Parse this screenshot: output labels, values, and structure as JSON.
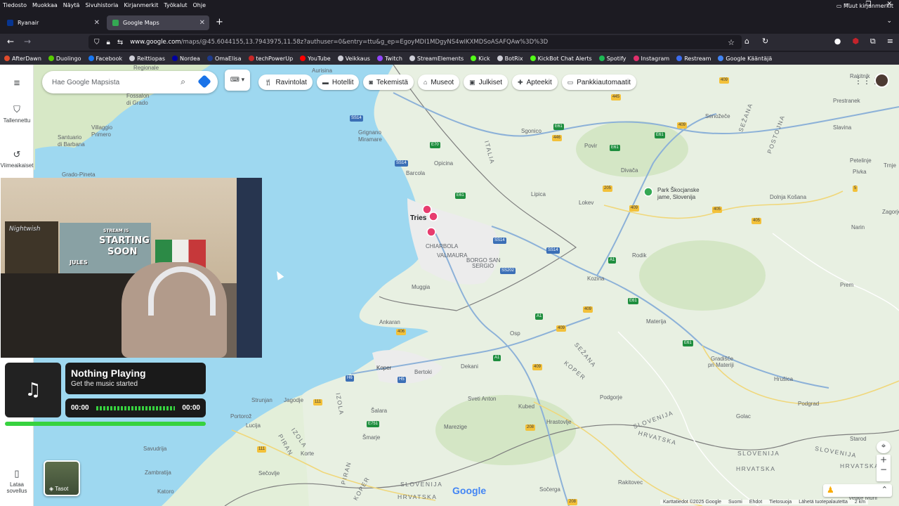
{
  "menubar": [
    "Tiedosto",
    "Muokkaa",
    "Näytä",
    "Sivuhistoria",
    "Kirjanmerkit",
    "Työkalut",
    "Ohje"
  ],
  "tabs": [
    {
      "title": "Ryanair"
    },
    {
      "title": "Google Maps"
    }
  ],
  "address_bar": {
    "host": "www.google.com",
    "path": "/maps/@45.6044155,13.7943975,11.58z?authuser=0&entry=ttu&g_ep=EgoyMDI1MDgyNS4wIKXMDSoASAFQAw%3D%3D"
  },
  "bookmarks": [
    {
      "label": "AfterDawn",
      "color": "#e04b2c"
    },
    {
      "label": "Duolingo",
      "color": "#58cc02"
    },
    {
      "label": "Facebook",
      "color": "#1877f2"
    },
    {
      "label": "Reittiopas",
      "color": "#cfcfd8"
    },
    {
      "label": "Nordea",
      "color": "#0000a0"
    },
    {
      "label": "OmaElisa",
      "color": "#1d3b8c"
    },
    {
      "label": "techPowerUp",
      "color": "#c82828"
    },
    {
      "label": "YouTube",
      "color": "#ff0000"
    },
    {
      "label": "Veikkaus",
      "color": "#cfcfd8"
    },
    {
      "label": "Twitch",
      "color": "#9146ff"
    },
    {
      "label": "StreamElements",
      "color": "#cfcfd8"
    },
    {
      "label": "Kick",
      "color": "#53fc18"
    },
    {
      "label": "BotRix",
      "color": "#cfcfd8"
    },
    {
      "label": "KickBot Chat Alerts",
      "color": "#53fc18"
    },
    {
      "label": "Spotify",
      "color": "#1db954"
    },
    {
      "label": "Instagram",
      "color": "#e1306c"
    },
    {
      "label": "Restream",
      "color": "#3c6cf0"
    },
    {
      "label": "Google Kääntäjä",
      "color": "#4285f4"
    }
  ],
  "bookmarks_other": "Muut kirjanmerkit",
  "maps": {
    "search_placeholder": "Hae Google Mapsista",
    "rail": {
      "saved": "Tallennettu",
      "recent": "Viimeaikaiset",
      "get_app": "Lataa sovellus"
    },
    "chips": [
      {
        "label": "Ravintolat",
        "icon": "fork-knife-icon"
      },
      {
        "label": "Hotellit",
        "icon": "bed-icon"
      },
      {
        "label": "Tekemistä",
        "icon": "camera-icon"
      },
      {
        "label": "Museot",
        "icon": "museum-icon"
      },
      {
        "label": "Julkiset",
        "icon": "train-icon"
      },
      {
        "label": "Apteekit",
        "icon": "pharmacy-icon"
      },
      {
        "label": "Pankkiautomaatit",
        "icon": "atm-icon"
      }
    ],
    "layers_label": "Tasot",
    "footer": [
      "Karttatiedot ©2025 Google",
      "Suomi",
      "Ehdot",
      "Tietosuoja",
      "Lähetä tuotepalautetta",
      "2 km"
    ],
    "logo": "Google",
    "places": [
      {
        "name": "Regionale",
        "cls": "",
        "id": "p-regionale"
      },
      {
        "name": "Aurisina",
        "cls": "",
        "id": "p-aurisina"
      },
      {
        "name": "Fossalon",
        "cls": "",
        "id": "p-fossalon"
      },
      {
        "name": "di Grado",
        "cls": "",
        "id": "p-digrado"
      },
      {
        "name": "Santuario",
        "cls": "",
        "id": "p-santuario"
      },
      {
        "name": "di Barbana",
        "cls": "",
        "id": "p-dibarbana"
      },
      {
        "name": "Villaggio",
        "cls": "",
        "id": "p-villaggio"
      },
      {
        "name": "Primero",
        "cls": "",
        "id": "p-primero"
      },
      {
        "name": "Grado-Pineta",
        "cls": "",
        "id": "p-gradopineta"
      },
      {
        "name": "Grignano",
        "cls": "",
        "id": "p-grignano"
      },
      {
        "name": "Miramare",
        "cls": "",
        "id": "p-miramare"
      },
      {
        "name": "Sgonico",
        "cls": "",
        "id": "p-sgonico"
      },
      {
        "name": "Opicina",
        "cls": "",
        "id": "p-opicina"
      },
      {
        "name": "Barcola",
        "cls": "",
        "id": "p-barcola"
      },
      {
        "name": "Tries",
        "cls": "big",
        "id": "p-trieste"
      },
      {
        "name": "CHIARBOLA",
        "cls": "",
        "id": "p-chiarbola"
      },
      {
        "name": "VALMAURA",
        "cls": "",
        "id": "p-valmaura"
      },
      {
        "name": "BORGO SAN",
        "cls": "",
        "id": "p-borgosan"
      },
      {
        "name": "SERGIO",
        "cls": "",
        "id": "p-sergio"
      },
      {
        "name": "Muggia",
        "cls": "",
        "id": "p-muggia"
      },
      {
        "name": "Ankaran",
        "cls": "",
        "id": "p-ankaran"
      },
      {
        "name": "Koper",
        "cls": "dark",
        "id": "p-koper"
      },
      {
        "name": "Bertoki",
        "cls": "",
        "id": "p-bertoki"
      },
      {
        "name": "Dekani",
        "cls": "",
        "id": "p-dekani"
      },
      {
        "name": "Osp",
        "cls": "",
        "id": "p-osp"
      },
      {
        "name": "Sveti Anton",
        "cls": "",
        "id": "p-svetianton"
      },
      {
        "name": "Kubed",
        "cls": "",
        "id": "p-kubed"
      },
      {
        "name": "Marezige",
        "cls": "",
        "id": "p-marezige"
      },
      {
        "name": "Hrastovlje",
        "cls": "",
        "id": "p-hrastovlje"
      },
      {
        "name": "Podgorje",
        "cls": "",
        "id": "p-podgorje"
      },
      {
        "name": "Strunjan",
        "cls": "",
        "id": "p-strunjan"
      },
      {
        "name": "Jagodje",
        "cls": "",
        "id": "p-jagodje"
      },
      {
        "name": "Šalara",
        "cls": "",
        "id": "p-salara"
      },
      {
        "name": "Portorož",
        "cls": "",
        "id": "p-portoroz"
      },
      {
        "name": "Lucija",
        "cls": "",
        "id": "p-lucija"
      },
      {
        "name": "Šmarje",
        "cls": "",
        "id": "p-smarje"
      },
      {
        "name": "Savudrija",
        "cls": "",
        "id": "p-savudrija"
      },
      {
        "name": "Zambratija",
        "cls": "",
        "id": "p-zambratija"
      },
      {
        "name": "Katoro",
        "cls": "",
        "id": "p-katoro"
      },
      {
        "name": "Korte",
        "cls": "",
        "id": "p-korte"
      },
      {
        "name": "Sečovlje",
        "cls": "",
        "id": "p-secovlje"
      },
      {
        "name": "Sočerga",
        "cls": "",
        "id": "p-socerga"
      },
      {
        "name": "Rakitovec",
        "cls": "",
        "id": "p-rakitovec"
      },
      {
        "name": "Golac",
        "cls": "",
        "id": "p-golac"
      },
      {
        "name": "Starod",
        "cls": "",
        "id": "p-starod"
      },
      {
        "name": "Podgrad",
        "cls": "",
        "id": "p-podgrad"
      },
      {
        "name": "Hrušica",
        "cls": "",
        "id": "p-hrusica"
      },
      {
        "name": "Gradišče",
        "cls": "",
        "id": "p-gradisce"
      },
      {
        "name": "pri Materiji",
        "cls": "",
        "id": "p-primateriji"
      },
      {
        "name": "Materija",
        "cls": "",
        "id": "p-materija"
      },
      {
        "name": "Kozina",
        "cls": "",
        "id": "p-kozina"
      },
      {
        "name": "Rodik",
        "cls": "",
        "id": "p-rodik"
      },
      {
        "name": "Lokev",
        "cls": "",
        "id": "p-lokev"
      },
      {
        "name": "Lipica",
        "cls": "",
        "id": "p-lipica"
      },
      {
        "name": "Divača",
        "cls": "",
        "id": "p-divaca"
      },
      {
        "name": "Povir",
        "cls": "",
        "id": "p-povir"
      },
      {
        "name": "Senožeče",
        "cls": "",
        "id": "p-senozece"
      },
      {
        "name": "Prestranek",
        "cls": "",
        "id": "p-prestranek"
      },
      {
        "name": "Slavina",
        "cls": "",
        "id": "p-slavina"
      },
      {
        "name": "Petelinje",
        "cls": "",
        "id": "p-petelinje"
      },
      {
        "name": "Pivka",
        "cls": "",
        "id": "p-pivka"
      },
      {
        "name": "Trnje",
        "cls": "",
        "id": "p-trnje"
      },
      {
        "name": "Dolnja Košana",
        "cls": "",
        "id": "p-dolnjakosana"
      },
      {
        "name": "Narin",
        "cls": "",
        "id": "p-narin"
      },
      {
        "name": "Zagorje",
        "cls": "",
        "id": "p-zagorje"
      },
      {
        "name": "Prem",
        "cls": "",
        "id": "p-prem"
      },
      {
        "name": "Rakitnik",
        "cls": "",
        "id": "p-rakitnik"
      },
      {
        "name": "Velike Muni",
        "cls": "",
        "id": "p-velikemuni"
      },
      {
        "name": "Park Škocjanske",
        "cls": "dark",
        "id": "p-park1"
      },
      {
        "name": "jame, Slovenija",
        "cls": "dark",
        "id": "p-park2"
      },
      {
        "name": "SLOVENIJA",
        "cls": "region",
        "id": "p-slov1"
      },
      {
        "name": "SLOVENIJA",
        "cls": "region",
        "id": "p-slov2"
      },
      {
        "name": "HRVATSKA",
        "cls": "region",
        "id": "p-hrv1"
      },
      {
        "name": "HRVATSKA",
        "cls": "region",
        "id": "p-hrv2"
      },
      {
        "name": "SLOVENIJA",
        "cls": "region",
        "id": "p-slov3"
      },
      {
        "name": "HRVATSKA",
        "cls": "region",
        "id": "p-hrv3"
      },
      {
        "name": "SLOVENIJA",
        "cls": "region",
        "id": "p-slov4"
      },
      {
        "name": "HRVATSKA",
        "cls": "region",
        "id": "p-hrv4"
      },
      {
        "name": "ITALIA",
        "cls": "region",
        "id": "p-italia"
      },
      {
        "name": "SEŽANA",
        "cls": "region",
        "id": "p-sezana1"
      },
      {
        "name": "POSTOJNA",
        "cls": "region",
        "id": "p-postojna"
      },
      {
        "name": "SEŽANA",
        "cls": "region",
        "id": "p-sezana2"
      },
      {
        "name": "KOPER",
        "cls": "region",
        "id": "p-koperreg"
      },
      {
        "name": "IZOLA",
        "cls": "region",
        "id": "p-izola1"
      },
      {
        "name": "IZOLA",
        "cls": "region",
        "id": "p-izola2"
      },
      {
        "name": "PIRAN",
        "cls": "region",
        "id": "p-piran1"
      },
      {
        "name": "PIRAN",
        "cls": "region",
        "id": "p-piran2"
      },
      {
        "name": "KOPER",
        "cls": "region",
        "id": "p-koper2"
      }
    ],
    "shields": [
      {
        "label": "445",
        "kind": "y",
        "id": "s1"
      },
      {
        "label": "409",
        "kind": "y",
        "id": "s2"
      },
      {
        "label": "409",
        "kind": "y",
        "id": "s3"
      },
      {
        "label": "446",
        "kind": "y",
        "id": "s4"
      },
      {
        "label": "E61",
        "kind": "g",
        "id": "s5"
      },
      {
        "label": "E61",
        "kind": "g",
        "id": "s6"
      },
      {
        "label": "E61",
        "kind": "g",
        "id": "s7"
      },
      {
        "label": "E70",
        "kind": "g",
        "id": "s8"
      },
      {
        "label": "E61",
        "kind": "g",
        "id": "s9"
      },
      {
        "label": "SS14",
        "kind": "b",
        "id": "s10"
      },
      {
        "label": "SS14",
        "kind": "b",
        "id": "s11"
      },
      {
        "label": "SS14",
        "kind": "b",
        "id": "s12"
      },
      {
        "label": "SS14",
        "kind": "b",
        "id": "s13"
      },
      {
        "label": "SS202",
        "kind": "b",
        "id": "s14"
      },
      {
        "label": "A1",
        "kind": "g",
        "id": "s15"
      },
      {
        "label": "A1",
        "kind": "g",
        "id": "s16"
      },
      {
        "label": "A1",
        "kind": "g",
        "id": "s17"
      },
      {
        "label": "E61",
        "kind": "g",
        "id": "s18"
      },
      {
        "label": "E61",
        "kind": "g",
        "id": "s19"
      },
      {
        "label": "409",
        "kind": "y",
        "id": "s20"
      },
      {
        "label": "409",
        "kind": "y",
        "id": "s21"
      },
      {
        "label": "406",
        "kind": "y",
        "id": "s22"
      },
      {
        "label": "405",
        "kind": "y",
        "id": "s23"
      },
      {
        "label": "405",
        "kind": "y",
        "id": "s24"
      },
      {
        "label": "205",
        "kind": "y",
        "id": "s25"
      },
      {
        "label": "5",
        "kind": "y",
        "id": "s26"
      },
      {
        "label": "H6",
        "kind": "b",
        "id": "s27"
      },
      {
        "label": "H5",
        "kind": "b",
        "id": "s28"
      },
      {
        "label": "111",
        "kind": "y",
        "id": "s29"
      },
      {
        "label": "111",
        "kind": "y",
        "id": "s30"
      },
      {
        "label": "E751",
        "kind": "g",
        "id": "s31"
      },
      {
        "label": "208",
        "kind": "y",
        "id": "s32"
      },
      {
        "label": "208",
        "kind": "y",
        "id": "s33"
      },
      {
        "label": "409",
        "kind": "y",
        "id": "s34"
      },
      {
        "label": "409",
        "kind": "y",
        "id": "s35"
      }
    ]
  },
  "webcam": {
    "poster_nightwish": "Nightwish",
    "poster_stream_1": "STARTING",
    "poster_stream_2": "SOON",
    "poster_stream_small": "STREAM IS",
    "poster_jules": "JULES"
  },
  "music": {
    "title": "Nothing Playing",
    "subtitle": "Get the music started",
    "time_start": "00:00",
    "time_end": "00:00",
    "progress": 1.0
  }
}
